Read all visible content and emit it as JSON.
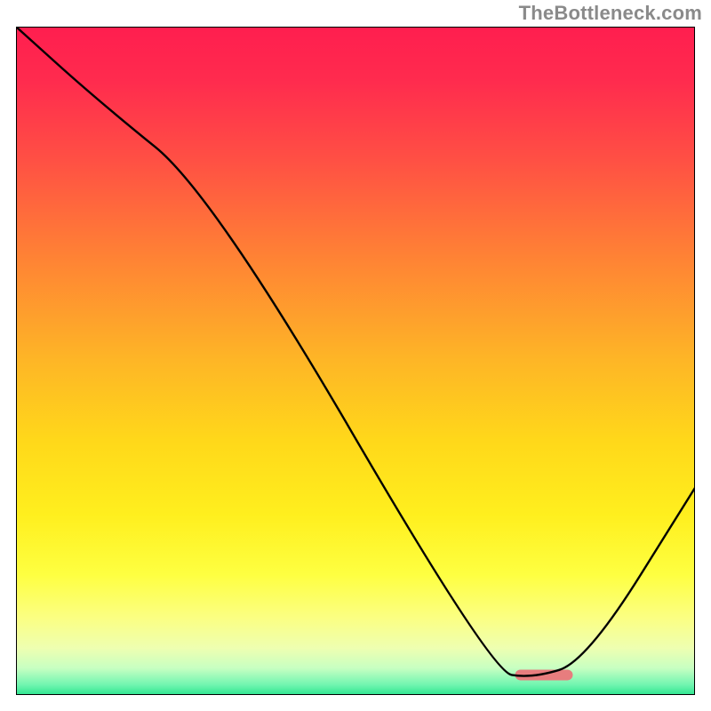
{
  "watermark": "TheBottleneck.com",
  "chart_data": {
    "type": "line",
    "x": [
      0,
      12,
      29,
      70,
      76,
      84,
      100
    ],
    "values": [
      100,
      89,
      75,
      3.5,
      2.5,
      5,
      31
    ],
    "title": "",
    "xlabel": "",
    "ylabel": "",
    "xlim": [
      0,
      100
    ],
    "ylim": [
      0,
      100
    ],
    "annotations": {
      "marker": {
        "x_start": 73.5,
        "x_end": 82,
        "y": 3,
        "color": "#e77d7e"
      }
    },
    "gradient_stops": [
      {
        "offset": 0.0,
        "color": "#ff1e4f"
      },
      {
        "offset": 0.08,
        "color": "#ff2b4e"
      },
      {
        "offset": 0.2,
        "color": "#ff5044"
      },
      {
        "offset": 0.35,
        "color": "#ff8434"
      },
      {
        "offset": 0.5,
        "color": "#feb626"
      },
      {
        "offset": 0.62,
        "color": "#ffd81a"
      },
      {
        "offset": 0.73,
        "color": "#ffef1e"
      },
      {
        "offset": 0.82,
        "color": "#feff41"
      },
      {
        "offset": 0.885,
        "color": "#fbff83"
      },
      {
        "offset": 0.93,
        "color": "#eeffb1"
      },
      {
        "offset": 0.96,
        "color": "#c7ffc2"
      },
      {
        "offset": 0.985,
        "color": "#70f5b0"
      },
      {
        "offset": 1.0,
        "color": "#2de58f"
      }
    ]
  }
}
